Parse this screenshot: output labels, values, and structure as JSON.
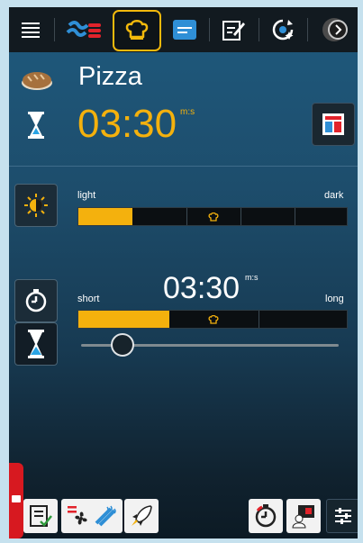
{
  "nav": {
    "tabs": [
      {
        "icon": "menu-icon"
      },
      {
        "icon": "cooking-steps-icon"
      },
      {
        "icon": "chef-hat-icon",
        "active": true
      },
      {
        "icon": "program-list-icon"
      },
      {
        "icon": "edit-icon"
      },
      {
        "icon": "cleaning-icon"
      },
      {
        "icon": "next-arrow-icon"
      }
    ]
  },
  "header": {
    "title": "Pizza",
    "timer_value": "03:30",
    "timer_unit": "m:s"
  },
  "browning": {
    "label_min": "light",
    "label_max": "dark",
    "level": 0.2
  },
  "cook_time": {
    "value": "03:30",
    "unit": "m:s",
    "label_min": "short",
    "label_max": "long",
    "level": 0.34,
    "slider_position": 0.16
  },
  "colors": {
    "accent": "#f4b10d",
    "active_tab_border": "#f3b90c",
    "side_tab": "#d71920"
  }
}
